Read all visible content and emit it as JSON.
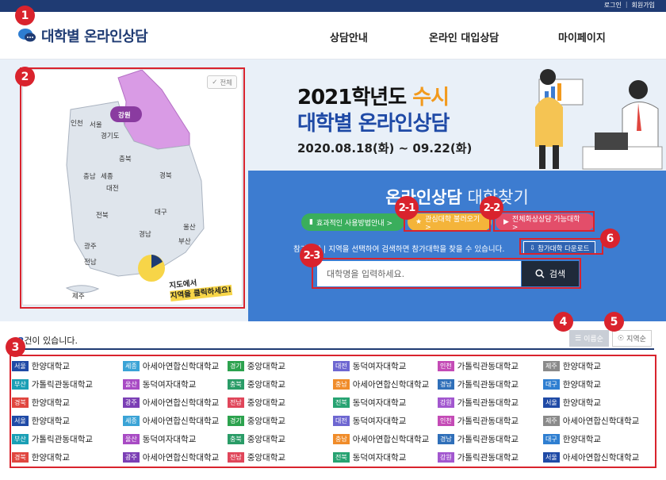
{
  "topbar": {
    "login": "로그인",
    "separator": "|",
    "signup": "회원가입"
  },
  "logo": {
    "title": "대학별 온라인상담"
  },
  "nav": [
    {
      "label": "상담안내"
    },
    {
      "label": "온라인 대입상담"
    },
    {
      "label": "마이페이지"
    }
  ],
  "hero": {
    "title_part1": "2021학년도 ",
    "title_accent": "수시",
    "title_line2": "대학별 온라인상담",
    "date": "2020.08.18(화) ~ 09.22(화)"
  },
  "search_panel": {
    "title_bold": "온라인상담",
    "title_light": " 대학찾기",
    "pill_guide": "효과적인 사용방법안내 >",
    "pill_favorites": "관심대학 불러오기 >",
    "pill_video": "전체화상상담 가능대학 >",
    "description": "참가대학 | 지역을 선택하여 검색하면 참가대학을 찾을 수 있습니다.",
    "download_label": "참가대학 다운로드",
    "search_placeholder": "대학명을 입력하세요.",
    "search_button": "검색"
  },
  "map": {
    "all_button": "전체",
    "regions": [
      "인천",
      "서울",
      "경기도",
      "강원",
      "충북",
      "충남",
      "세종",
      "대전",
      "경북",
      "전북",
      "대구",
      "울산",
      "경남",
      "광주",
      "부산",
      "전남",
      "제주"
    ],
    "note_line1": "지도에서",
    "note_line2": "지역을 클릭하세요!"
  },
  "results": {
    "count_prefix": "",
    "count_value": "42",
    "count_suffix": "건이 있습니다.",
    "sort_name": "이름순",
    "sort_region": "지역순"
  },
  "region_colors": {
    "서울": "#1f4aa6",
    "부산": "#1a9fb5",
    "경북": "#e0463f",
    "세종": "#3aa3d6",
    "울산": "#a84bc4",
    "광주": "#7b3fb5",
    "경기": "#2ca24e",
    "충북": "#2a9c67",
    "전남": "#e0465a",
    "대전": "#6e67d1",
    "충남": "#f08c2a",
    "전북": "#27a372",
    "인천": "#c44bb6",
    "경남": "#2f6fb9",
    "강원": "#a257cf",
    "제주": "#8a8a8a",
    "대구": "#2f7fd1"
  },
  "universities": [
    [
      {
        "region": "서울",
        "name": "한양대학교"
      },
      {
        "region": "부산",
        "name": "가톨릭관동대학교"
      },
      {
        "region": "경북",
        "name": "한양대학교"
      },
      {
        "region": "서울",
        "name": "한양대학교"
      },
      {
        "region": "부산",
        "name": "가톨릭관동대학교"
      },
      {
        "region": "경북",
        "name": "한양대학교"
      }
    ],
    [
      {
        "region": "세종",
        "name": "아세아연합신학대학교"
      },
      {
        "region": "울산",
        "name": "동덕여자대학교"
      },
      {
        "region": "광주",
        "name": "아세아연합신학대학교"
      },
      {
        "region": "세종",
        "name": "아세아연합신학대학교"
      },
      {
        "region": "울산",
        "name": "동덕여자대학교"
      },
      {
        "region": "광주",
        "name": "아세아연합신학대학교"
      }
    ],
    [
      {
        "region": "경기",
        "name": "중앙대학교"
      },
      {
        "region": "충북",
        "name": "중앙대학교"
      },
      {
        "region": "전남",
        "name": "중앙대학교"
      },
      {
        "region": "경기",
        "name": "중앙대학교"
      },
      {
        "region": "충북",
        "name": "중앙대학교"
      },
      {
        "region": "전남",
        "name": "중앙대학교"
      }
    ],
    [
      {
        "region": "대전",
        "name": "동덕여자대학교"
      },
      {
        "region": "충남",
        "name": "아세아연합신학대학교"
      },
      {
        "region": "전북",
        "name": "동덕여자대학교"
      },
      {
        "region": "대전",
        "name": "동덕여자대학교"
      },
      {
        "region": "충남",
        "name": "아세아연합신학대학교"
      },
      {
        "region": "전북",
        "name": "동덕여자대학교"
      }
    ],
    [
      {
        "region": "인천",
        "name": "가톨릭관동대학교"
      },
      {
        "region": "경남",
        "name": "가톨릭관동대학교"
      },
      {
        "region": "강원",
        "name": "가톨릭관동대학교"
      },
      {
        "region": "인천",
        "name": "가톨릭관동대학교"
      },
      {
        "region": "경남",
        "name": "가톨릭관동대학교"
      },
      {
        "region": "강원",
        "name": "가톨릭관동대학교"
      }
    ],
    [
      {
        "region": "제주",
        "name": "한양대학교"
      },
      {
        "region": "대구",
        "name": "한양대학교"
      },
      {
        "region": "서울",
        "name": "한양대학교"
      },
      {
        "region": "제주",
        "name": "아세아연합신학대학교"
      },
      {
        "region": "대구",
        "name": "한양대학교"
      },
      {
        "region": "서울",
        "name": "아세아연합신학대학교"
      }
    ]
  ],
  "annotations": {
    "n1": "1",
    "n2": "2",
    "n21": "2-1",
    "n22": "2-2",
    "n23": "2-3",
    "n3": "3",
    "n4": "4",
    "n5": "5",
    "n6": "6"
  }
}
